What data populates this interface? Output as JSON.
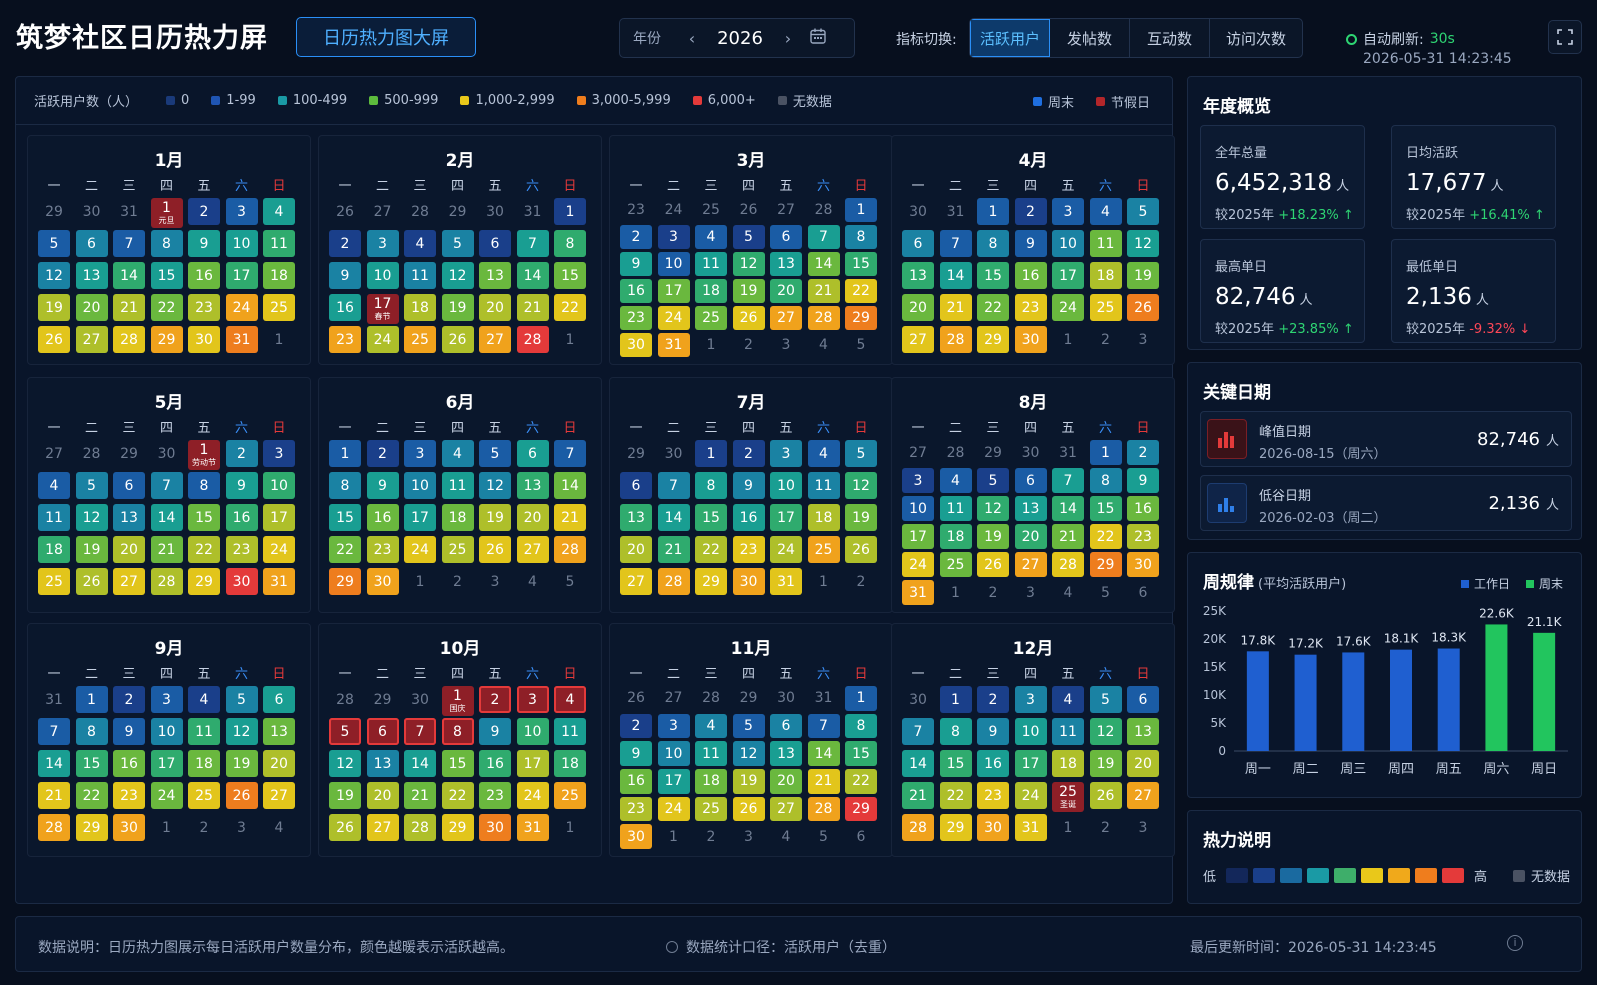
{
  "header": {
    "title": "筑梦社区日历热力屏",
    "badge": "日历热力图大屏",
    "year_label": "年份",
    "year": "2026",
    "metric_label": "指标切换:",
    "metric_tabs": [
      "活跃用户",
      "发帖数",
      "互动数",
      "访问次数"
    ],
    "active_metric_index": 0,
    "refresh_label": "自动刷新:",
    "refresh_value": "30s",
    "timestamp": "2026-05-31 14:23:45"
  },
  "legend": {
    "title": "活跃用户数（人）",
    "items": [
      {
        "label": "0",
        "color": "#1a3a7a"
      },
      {
        "label": "1-99",
        "color": "#1f55b3"
      },
      {
        "label": "100-499",
        "color": "#1a9aa5"
      },
      {
        "label": "500-999",
        "color": "#5dbb3d"
      },
      {
        "label": "1,000-2,999",
        "color": "#e9c81a"
      },
      {
        "label": "3,000-5,999",
        "color": "#ef7d1d"
      },
      {
        "label": "6,000+",
        "color": "#e43a3a"
      },
      {
        "label": "无数据",
        "color": "#4a5263"
      }
    ],
    "weekend_label": "周末",
    "weekend_color": "#1f6fe0",
    "holiday_label": "节假日",
    "holiday_color": "#b3262a"
  },
  "weekdays": [
    "一",
    "二",
    "三",
    "四",
    "五",
    "六",
    "日"
  ],
  "months": [
    {
      "name": "1月",
      "lead": [
        29,
        30,
        31
      ],
      "days": 31,
      "holidays": {
        "1": "元旦"
      }
    },
    {
      "name": "2月",
      "lead": [
        26,
        27,
        28,
        29,
        30,
        31
      ],
      "days": 28,
      "holidays": {
        "17": "春节"
      }
    },
    {
      "name": "3月",
      "lead": [
        23,
        24,
        25,
        26,
        27,
        28
      ],
      "days": 31,
      "holidays": {}
    },
    {
      "name": "4月",
      "lead": [
        30,
        31
      ],
      "days": 30,
      "holidays": {}
    },
    {
      "name": "5月",
      "lead": [
        27,
        28,
        29,
        30
      ],
      "days": 31,
      "holidays": {
        "1": "劳动节"
      }
    },
    {
      "name": "6月",
      "lead": [],
      "days": 30,
      "holidays": {}
    },
    {
      "name": "7月",
      "lead": [
        29,
        30
      ],
      "days": 31,
      "holidays": {}
    },
    {
      "name": "8月",
      "lead": [
        27,
        28,
        29,
        30,
        31
      ],
      "days": 31,
      "holidays": {}
    },
    {
      "name": "9月",
      "lead": [
        31
      ],
      "days": 30,
      "holidays": {}
    },
    {
      "name": "10月",
      "lead": [
        28,
        29,
        30
      ],
      "days": 31,
      "holidays": {
        "1": "国庆"
      }
    },
    {
      "name": "11月",
      "lead": [
        26,
        27,
        28,
        29,
        30,
        31
      ],
      "days": 30,
      "holidays": {}
    },
    {
      "name": "12月",
      "lead": [
        30
      ],
      "days": 31,
      "holidays": {
        "25": "圣诞"
      }
    }
  ],
  "overview": {
    "title": "年度概览",
    "cards": [
      {
        "label": "全年总量",
        "value": "6,452,318",
        "unit": "人",
        "cmp_label": "较2025年",
        "change": "+18.23%",
        "trend": "up"
      },
      {
        "label": "日均活跃",
        "value": "17,677",
        "unit": "人",
        "cmp_label": "较2025年",
        "change": "+16.41%",
        "trend": "up"
      },
      {
        "label": "最高单日",
        "value": "82,746",
        "unit": "人",
        "cmp_label": "较2025年",
        "change": "+23.85%",
        "trend": "up"
      },
      {
        "label": "最低单日",
        "value": "2,136",
        "unit": "人",
        "cmp_label": "较2025年",
        "change": "-9.32%",
        "trend": "down"
      }
    ]
  },
  "key_dates": {
    "title": "关键日期",
    "items": [
      {
        "label": "峰值日期",
        "date": "2026-08-15（周六）",
        "value": "82,746",
        "unit": "人",
        "icon": "bar-chart-icon"
      },
      {
        "label": "低谷日期",
        "date": "2026-02-03（周二）",
        "value": "2,136",
        "unit": "人",
        "icon": "bar-chart-icon"
      }
    ]
  },
  "weekly": {
    "title": "周规律",
    "subtitle": "(平均活跃用户)",
    "legend_workday": "工作日",
    "legend_weekend": "周末",
    "workday_color": "#1f5fd0",
    "weekend_color": "#22c55e"
  },
  "chart_data": {
    "type": "bar",
    "categories": [
      "周一",
      "周二",
      "周三",
      "周四",
      "周五",
      "周六",
      "周日"
    ],
    "values": [
      17800,
      17200,
      17600,
      18100,
      18300,
      22600,
      21100
    ],
    "data_labels": [
      "17.8K",
      "17.2K",
      "17.6K",
      "18.1K",
      "18.3K",
      "22.6K",
      "21.1K"
    ],
    "series": [
      {
        "name": "工作日",
        "values": [
          17800,
          17200,
          17600,
          18100,
          18300,
          null,
          null
        ]
      },
      {
        "name": "周末",
        "values": [
          null,
          null,
          null,
          null,
          null,
          22600,
          21100
        ]
      }
    ],
    "ylim": [
      0,
      25000
    ],
    "yticks": [
      0,
      5000,
      10000,
      15000,
      20000,
      25000
    ],
    "ytick_labels": [
      "0",
      "5K",
      "10K",
      "15K",
      "20K",
      "25K"
    ],
    "xlabel": "",
    "ylabel": "",
    "grid": false,
    "legend_position": "top-right"
  },
  "heat_note": {
    "title": "热力说明",
    "low": "低",
    "high": "高",
    "nodata": "无数据",
    "scale": [
      "#13275a",
      "#1a3f8a",
      "#1a6aa0",
      "#1a9aa5",
      "#3eae6a",
      "#e9c81a",
      "#f0a91b",
      "#ef7d1d",
      "#e43a3a"
    ],
    "nodata_color": "#4a5263"
  },
  "footer": {
    "note": "数据说明：日历热力图展示每日活跃用户数量分布，颜色越暖表示活跃越高。",
    "caliber": "数据统计口径：活跃用户（去重）",
    "updated": "最后更新时间：2026-05-31 14:23:45"
  }
}
